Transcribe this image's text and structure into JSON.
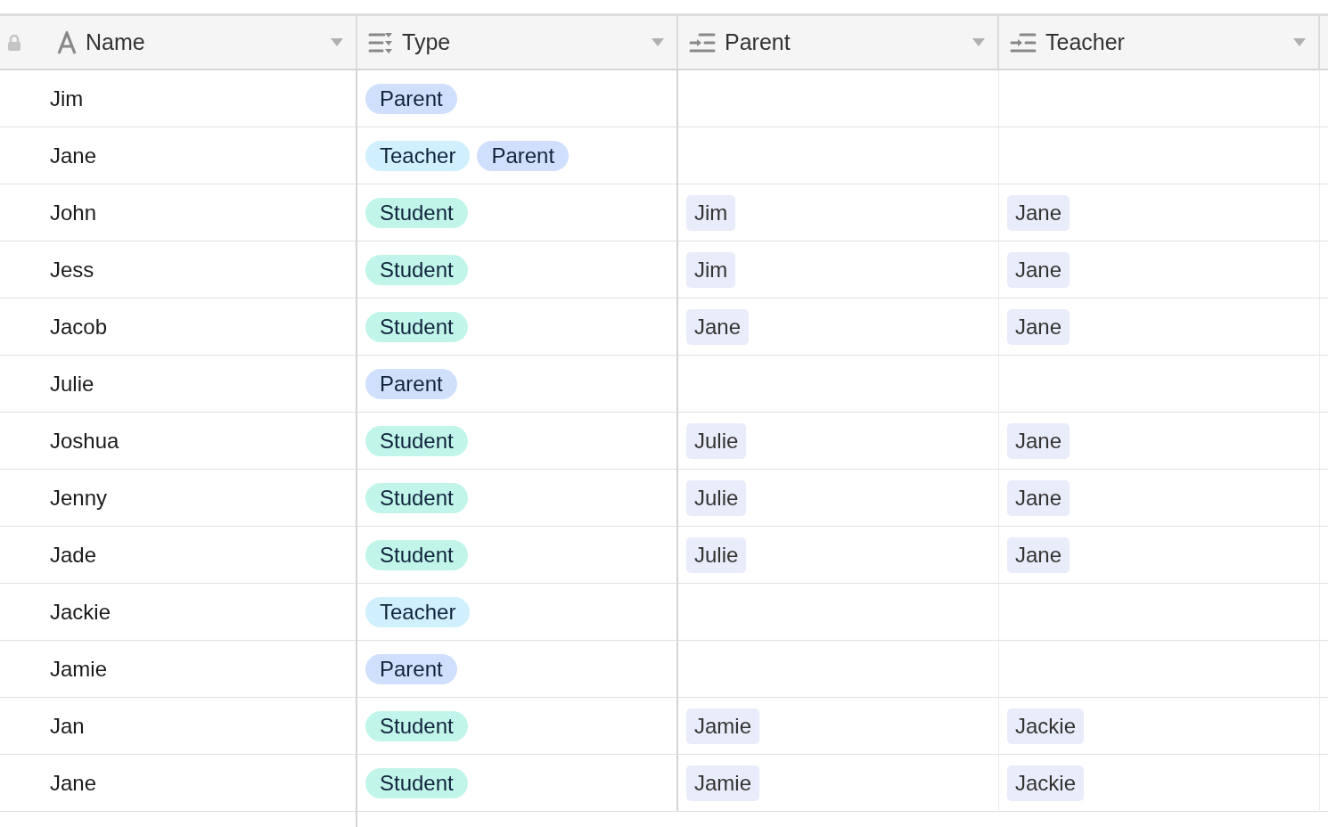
{
  "columns": [
    {
      "kind": "text",
      "label": "Name"
    },
    {
      "kind": "select",
      "label": "Type"
    },
    {
      "kind": "link",
      "label": "Parent"
    },
    {
      "kind": "link",
      "label": "Teacher"
    }
  ],
  "rows": [
    {
      "name": "Jim",
      "type": [
        {
          "label": "Parent",
          "color": "#d0e0fc"
        }
      ],
      "parent": [],
      "teacher": []
    },
    {
      "name": "Jane",
      "type": [
        {
          "label": "Teacher",
          "color": "#d0f0fd"
        },
        {
          "label": "Parent",
          "color": "#d0e0fc"
        }
      ],
      "parent": [],
      "teacher": []
    },
    {
      "name": "John",
      "type": [
        {
          "label": "Student",
          "color": "#c2f5e9"
        }
      ],
      "parent": [
        "Jim"
      ],
      "teacher": [
        "Jane"
      ]
    },
    {
      "name": "Jess",
      "type": [
        {
          "label": "Student",
          "color": "#c2f5e9"
        }
      ],
      "parent": [
        "Jim"
      ],
      "teacher": [
        "Jane"
      ]
    },
    {
      "name": "Jacob",
      "type": [
        {
          "label": "Student",
          "color": "#c2f5e9"
        }
      ],
      "parent": [
        "Jane"
      ],
      "teacher": [
        "Jane"
      ]
    },
    {
      "name": "Julie",
      "type": [
        {
          "label": "Parent",
          "color": "#d0e0fc"
        }
      ],
      "parent": [],
      "teacher": []
    },
    {
      "name": "Joshua",
      "type": [
        {
          "label": "Student",
          "color": "#c2f5e9"
        }
      ],
      "parent": [
        "Julie"
      ],
      "teacher": [
        "Jane"
      ]
    },
    {
      "name": "Jenny",
      "type": [
        {
          "label": "Student",
          "color": "#c2f5e9"
        }
      ],
      "parent": [
        "Julie"
      ],
      "teacher": [
        "Jane"
      ]
    },
    {
      "name": "Jade",
      "type": [
        {
          "label": "Student",
          "color": "#c2f5e9"
        }
      ],
      "parent": [
        "Julie"
      ],
      "teacher": [
        "Jane"
      ]
    },
    {
      "name": "Jackie",
      "type": [
        {
          "label": "Teacher",
          "color": "#d0f0fd"
        }
      ],
      "parent": [],
      "teacher": []
    },
    {
      "name": "Jamie",
      "type": [
        {
          "label": "Parent",
          "color": "#d0e0fc"
        }
      ],
      "parent": [],
      "teacher": []
    },
    {
      "name": "Jan",
      "type": [
        {
          "label": "Student",
          "color": "#c2f5e9"
        }
      ],
      "parent": [
        "Jamie"
      ],
      "teacher": [
        "Jackie"
      ]
    },
    {
      "name": "Jane",
      "type": [
        {
          "label": "Student",
          "color": "#c2f5e9"
        }
      ],
      "parent": [
        "Jamie"
      ],
      "teacher": [
        "Jackie"
      ]
    }
  ]
}
